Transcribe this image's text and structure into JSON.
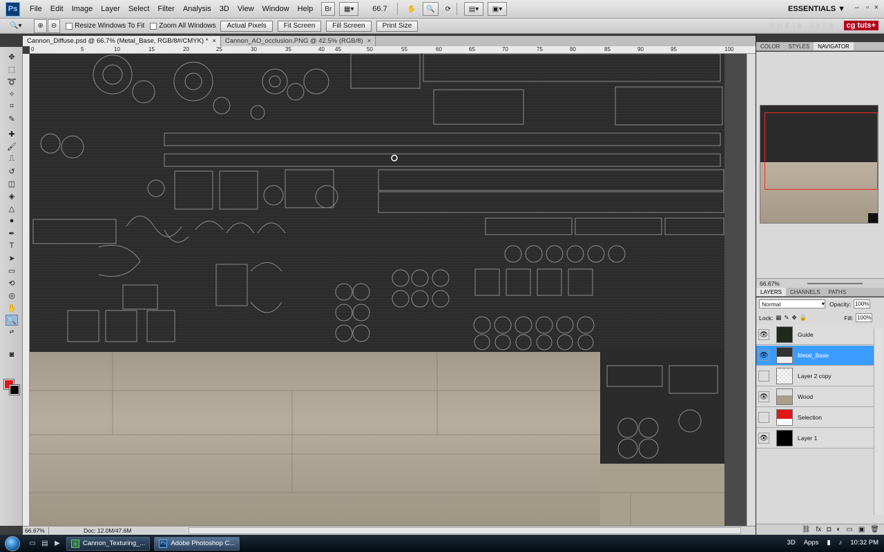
{
  "menubar": {
    "logo": "Ps",
    "items": [
      "File",
      "Edit",
      "Image",
      "Layer",
      "Select",
      "Filter",
      "Analysis",
      "3D",
      "View",
      "Window",
      "Help"
    ],
    "br_label": "Br",
    "zoom": "66.7",
    "workspace": "ESSENTIALS ▼"
  },
  "options": {
    "checks": [
      "Resize Windows To Fit",
      "Zoom All Windows"
    ],
    "buttons": [
      "Actual Pixels",
      "Fit Screen",
      "Fill Screen",
      "Print Size"
    ],
    "author": "CHRIS TATE",
    "brand": "cg tuts+"
  },
  "tabs": [
    {
      "label": "Cannon_Diffuse.psd @ 66.7% (Metal_Base, RGB/8#/CMYK) *",
      "close": "×"
    },
    {
      "label": "Cannon_AO_occlusion.PNG @ 42.5% (RGB/8)",
      "close": "×"
    }
  ],
  "ruler": {
    "top": [
      "0",
      "5",
      "10",
      "15",
      "20",
      "25",
      "30",
      "35",
      "40",
      "45",
      "50",
      "55",
      "60",
      "65",
      "70",
      "75",
      "80",
      "85",
      "90",
      "95",
      "100"
    ]
  },
  "status": {
    "zoom": "66.67%",
    "doc": "Doc: 12.0M/47.6M"
  },
  "panels": {
    "top_tabs": [
      "COLOR",
      "STYLES",
      "NAVIGATOR"
    ],
    "nav_zoom": "66.67%",
    "layer_tabs": [
      "LAYERS",
      "CHANNELS",
      "PATHS"
    ],
    "blend_mode": "Normal",
    "opacity_label": "Opacity:",
    "opacity": "100%",
    "lock_label": "Lock:",
    "fill_label": "Fill:",
    "fill": "100%",
    "layers": [
      {
        "name": "Guide",
        "visible": "👁"
      },
      {
        "name": "Metal_Base",
        "visible": "👁"
      },
      {
        "name": "Layer 2 copy",
        "visible": ""
      },
      {
        "name": "Wood",
        "visible": "👁"
      },
      {
        "name": "Selection",
        "visible": ""
      },
      {
        "name": "Layer 1",
        "visible": "👁"
      }
    ]
  },
  "taskbar": {
    "tasks": [
      "Cannon_Texturing_...",
      "Adobe Photoshop C..."
    ],
    "tray": [
      "3D",
      "Apps",
      "10:32 PM"
    ]
  }
}
